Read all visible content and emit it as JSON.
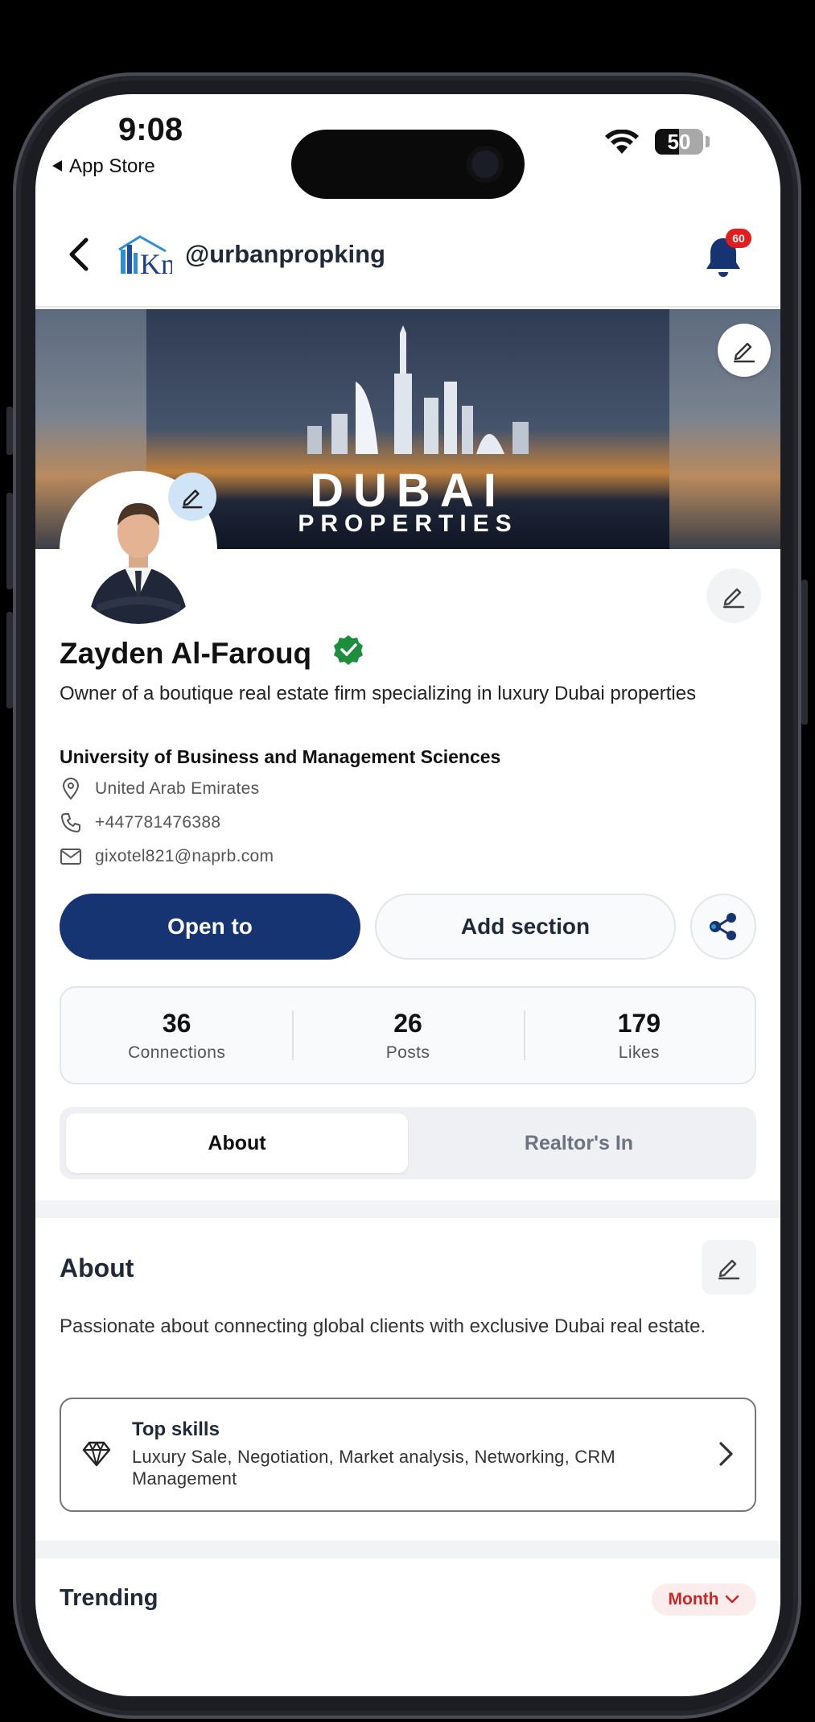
{
  "status_bar": {
    "time": "9:08",
    "back_app_label": "App Store",
    "battery_level": "50"
  },
  "header": {
    "handle": "@urbanpropking",
    "notification_count": "60",
    "logo_text": "Kn"
  },
  "banner": {
    "title": "DUBAI",
    "subtitle": "PROPERTIES"
  },
  "profile": {
    "name": "Zayden Al-Farouq",
    "bio": "Owner of a boutique real estate firm specializing in luxury Dubai properties",
    "university": "University of Business and Management Sciences",
    "location": "United Arab Emirates",
    "phone": "+447781476388",
    "email": "gixotel821@naprb.com"
  },
  "actions": {
    "primary_label": "Open to",
    "secondary_label": "Add section"
  },
  "stats": [
    {
      "value": "36",
      "label": "Connections"
    },
    {
      "value": "26",
      "label": "Posts"
    },
    {
      "value": "179",
      "label": "Likes"
    }
  ],
  "tabs": [
    {
      "label": "About",
      "active": true
    },
    {
      "label": "Realtor's In",
      "active": false
    }
  ],
  "about": {
    "title": "About",
    "text": "Passionate about connecting global clients with exclusive Dubai real estate.",
    "skills_title": "Top skills",
    "skills_list": "Luxury Sale, Negotiation, Market analysis, Networking, CRM Management"
  },
  "trending": {
    "title": "Trending",
    "period": "Month"
  },
  "colors": {
    "primary": "#163372",
    "verified": "#1e8e3e",
    "badge": "#e11d1d",
    "month_chip_text": "#c62828"
  }
}
